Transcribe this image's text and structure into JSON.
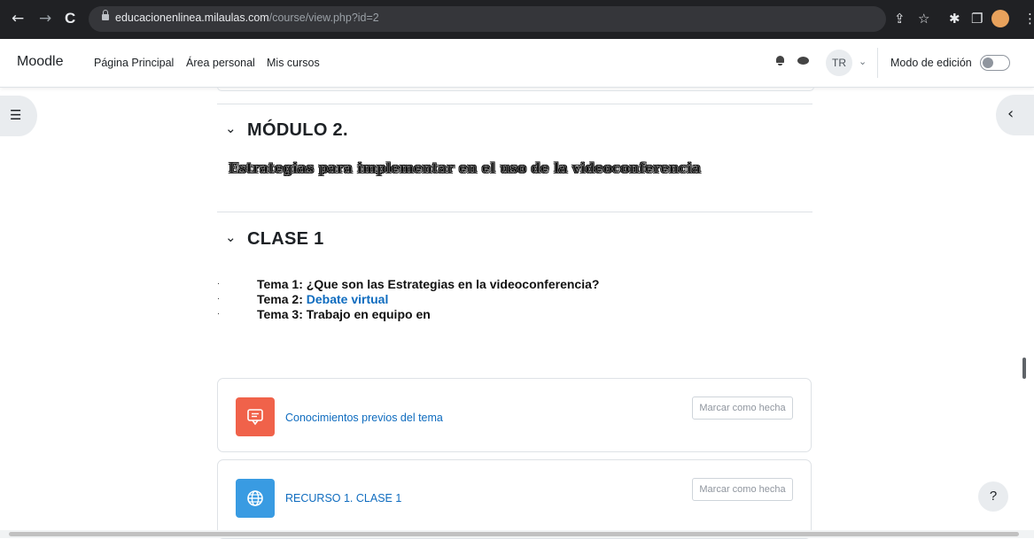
{
  "browser": {
    "url_domain": "educacionenlinea.milaulas.com",
    "url_path": "/course/view.php?id=2",
    "back_glyph": "←",
    "forward_glyph": "→",
    "reload_glyph": "C",
    "share_glyph": "⇪",
    "star_glyph": "☆",
    "extensions_glyph": "✱",
    "sidepanel_glyph": "❐",
    "menu_glyph": "⋮"
  },
  "navbar": {
    "brand": "Moodle",
    "links": [
      "Página Principal",
      "Área personal",
      "Mis cursos"
    ],
    "avatar_initials": "TR",
    "caret": "⌄",
    "edit_mode_label": "Modo de edición",
    "edit_mode_on": false
  },
  "drawers": {
    "left_glyph": "☰",
    "right_glyph": "‹"
  },
  "modulo": {
    "chevron": "⌄",
    "title": "MÓDULO 2.",
    "subtitle": "Estrategias para implementar en el uso de la videoconferencia"
  },
  "clase": {
    "chevron": "⌄",
    "title": "CLASE 1",
    "bullet": "·",
    "topics": [
      {
        "prefix": "Tema 1: ¿Que son las Estrategias en la videoconferencia?",
        "link": ""
      },
      {
        "prefix": "Tema 2: ",
        "link": "Debate virtual"
      },
      {
        "prefix": "Tema 3: Trabajo en equipo en",
        "link": ""
      }
    ]
  },
  "activities": [
    {
      "name": "Conocimientos previos del tema",
      "icon": "forum-icon",
      "icon_color": "#f0624a",
      "button": "Marcar como hecha"
    },
    {
      "name": "RECURSO 1. CLASE 1",
      "icon": "url-globe-icon",
      "icon_color": "#399be2",
      "button": "Marcar como hecha"
    }
  ],
  "help": {
    "label": "?"
  }
}
